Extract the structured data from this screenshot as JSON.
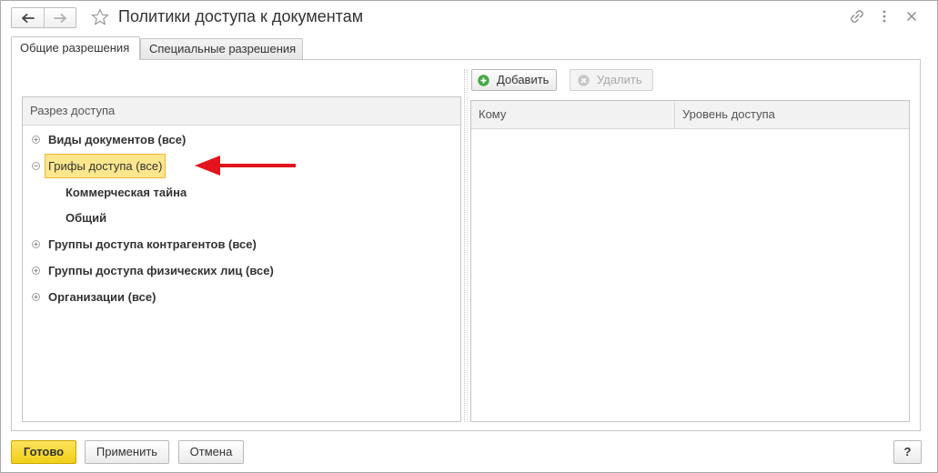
{
  "window": {
    "title": "Политики доступа к документам",
    "nav": {
      "back_icon": "arrow-left-icon",
      "forward_icon": "arrow-right-icon",
      "forward_enabled": false
    },
    "favorite_icon": "star-icon",
    "actions": [
      "link-icon",
      "more-icon",
      "close-icon"
    ]
  },
  "tabs": [
    {
      "label": "Общие разрешения",
      "active": true
    },
    {
      "label": "Специальные разрешения",
      "active": false
    }
  ],
  "access_slices": {
    "header": "Разрез доступа",
    "items": [
      {
        "label": "Виды документов (все)",
        "level": 0,
        "expander": "plus-circle-icon"
      },
      {
        "label": "Грифы доступа (все)",
        "level": 0,
        "expander": "minus-circle-icon",
        "selected": true
      },
      {
        "label": "Коммерческая тайна",
        "level": 1
      },
      {
        "label": "Общий",
        "level": 1
      },
      {
        "label": "Группы доступа контрагентов (все)",
        "level": 0,
        "expander": "plus-circle-icon"
      },
      {
        "label": "Группы доступа физических лиц (все)",
        "level": 0,
        "expander": "plus-circle-icon"
      },
      {
        "label": "Организации (все)",
        "level": 0,
        "expander": "plus-circle-icon"
      }
    ]
  },
  "permissions": {
    "toolbar": {
      "add_label": "Добавить",
      "add_icon": "plus-circle-icon",
      "delete_label": "Удалить",
      "delete_icon": "remove-circle-icon",
      "delete_enabled": false
    },
    "columns": [
      "Кому",
      "Уровень доступа"
    ],
    "rows": []
  },
  "footer": {
    "done_label": "Готово",
    "apply_label": "Применить",
    "cancel_label": "Отмена",
    "help_label": "?"
  },
  "colors": {
    "accent_yellow": "#f2cf18",
    "selection_bg": "#fde68c",
    "selection_border": "#f0b734",
    "add_icon_green": "#46a843",
    "annotation_red": "#e3141b"
  }
}
